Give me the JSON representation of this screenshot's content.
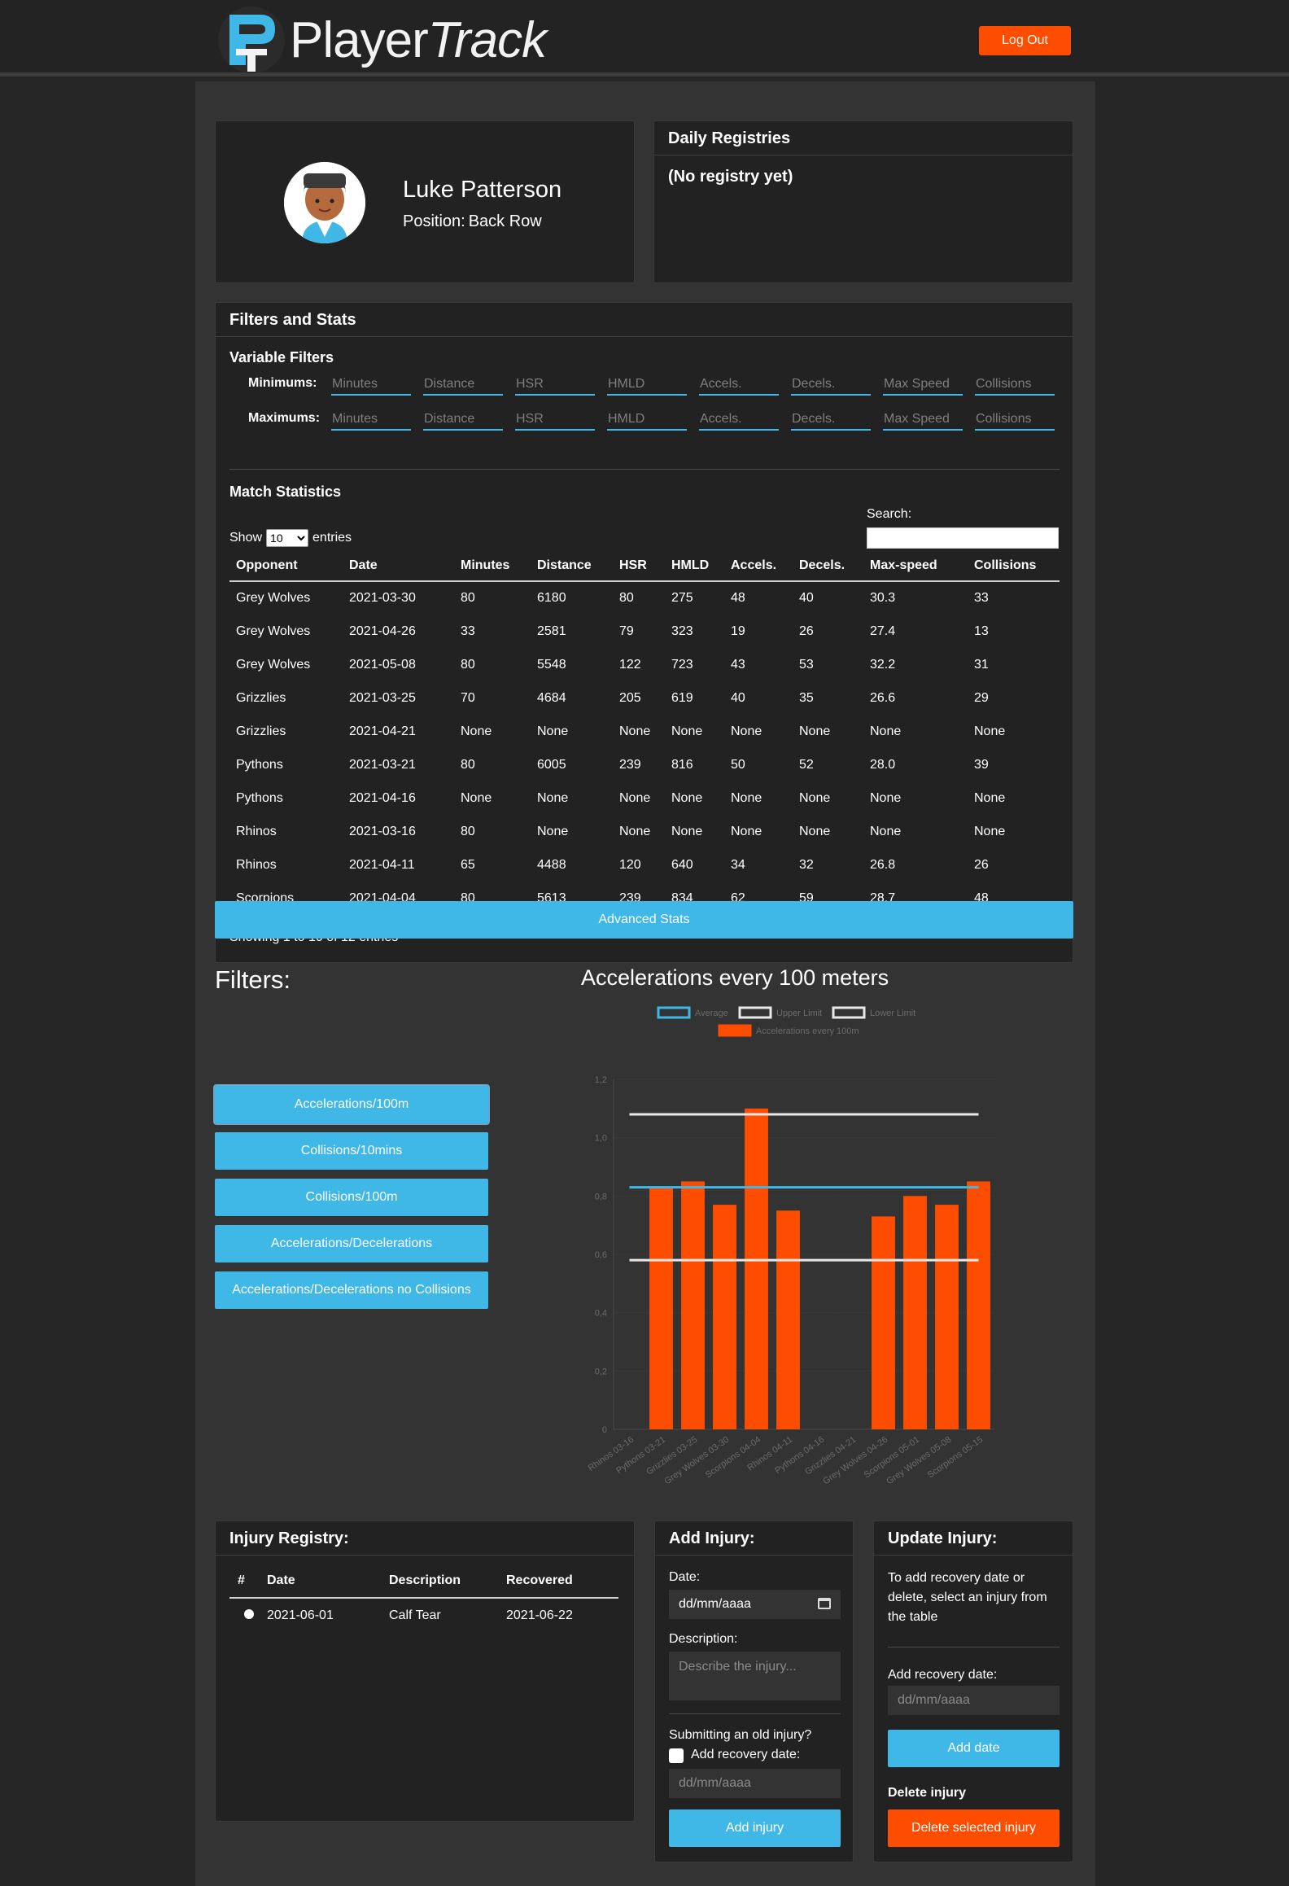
{
  "app": {
    "brand_part1": "Player",
    "brand_part2": "Track",
    "logout_label": "Log Out"
  },
  "profile": {
    "name": "Luke Patterson",
    "position_label": "Position:",
    "position": "Back Row"
  },
  "registries": {
    "title": "Daily Registries",
    "empty": "(No registry yet)"
  },
  "filters_stats": {
    "title": "Filters and Stats",
    "variable_filters_title": "Variable Filters",
    "min_label": "Minimums:",
    "max_label": "Maximums:",
    "placeholders": [
      "Minutes",
      "Distance",
      "HSR",
      "HMLD",
      "Accels.",
      "Decels.",
      "Max Speed",
      "Collisions"
    ],
    "match_stats_title": "Match Statistics",
    "show_label": "Show",
    "entries_label": "entries",
    "entries_value": "10",
    "search_label": "Search:",
    "columns": [
      "Opponent",
      "Date",
      "Minutes",
      "Distance",
      "HSR",
      "HMLD",
      "Accels.",
      "Decels.",
      "Max-speed",
      "Collisions"
    ],
    "rows": [
      [
        "Grey Wolves",
        "2021-03-30",
        "80",
        "6180",
        "80",
        "275",
        "48",
        "40",
        "30.3",
        "33"
      ],
      [
        "Grey Wolves",
        "2021-04-26",
        "33",
        "2581",
        "79",
        "323",
        "19",
        "26",
        "27.4",
        "13"
      ],
      [
        "Grey Wolves",
        "2021-05-08",
        "80",
        "5548",
        "122",
        "723",
        "43",
        "53",
        "32.2",
        "31"
      ],
      [
        "Grizzlies",
        "2021-03-25",
        "70",
        "4684",
        "205",
        "619",
        "40",
        "35",
        "26.6",
        "29"
      ],
      [
        "Grizzlies",
        "2021-04-21",
        "None",
        "None",
        "None",
        "None",
        "None",
        "None",
        "None",
        "None"
      ],
      [
        "Pythons",
        "2021-03-21",
        "80",
        "6005",
        "239",
        "816",
        "50",
        "52",
        "28.0",
        "39"
      ],
      [
        "Pythons",
        "2021-04-16",
        "None",
        "None",
        "None",
        "None",
        "None",
        "None",
        "None",
        "None"
      ],
      [
        "Rhinos",
        "2021-03-16",
        "80",
        "None",
        "None",
        "None",
        "None",
        "None",
        "None",
        "None"
      ],
      [
        "Rhinos",
        "2021-04-11",
        "65",
        "4488",
        "120",
        "640",
        "34",
        "32",
        "26.8",
        "26"
      ],
      [
        "Scorpions",
        "2021-04-04",
        "80",
        "5613",
        "239",
        "834",
        "62",
        "59",
        "28.7",
        "48"
      ]
    ],
    "showing_text": "Showing 1 to 10 of 12 entries"
  },
  "advanced_stats_label": "Advanced Stats",
  "filters_panel": {
    "title": "Filters:",
    "buttons": [
      "Accelerations/100m",
      "Collisions/10mins",
      "Collisions/100m",
      "Accelerations/Decelerations",
      "Accelerations/Decelerations no Collisions"
    ]
  },
  "chart_title": "Accelerations every 100 meters",
  "chart_data": {
    "type": "bar",
    "title": "Accelerations every 100 meters",
    "categories": [
      "Rhinos 03-16",
      "Pythons 03-21",
      "Grizzlies 03-25",
      "Grey Wolves 03-30",
      "Scorpions 04-04",
      "Rhinos 04-11",
      "Pythons 04-16",
      "Grizzlies 04-21",
      "Grey Wolves 04-26",
      "Scorpions 05-01",
      "Grey Wolves 05-08",
      "Scorpions 05-15"
    ],
    "series": [
      {
        "name": "Accelerations every 100m",
        "type": "bar",
        "color": "#ff4d00",
        "values": [
          null,
          0.83,
          0.85,
          0.77,
          1.1,
          0.75,
          null,
          null,
          0.73,
          0.8,
          0.77,
          0.85
        ]
      },
      {
        "name": "Average",
        "type": "line",
        "color": "#3fb8e8",
        "values": [
          0.83,
          0.83,
          0.83,
          0.83,
          0.83,
          0.83,
          0.83,
          0.83,
          0.83,
          0.83,
          0.83,
          0.83
        ]
      },
      {
        "name": "Upper Limit",
        "type": "line",
        "color": "#e8e8e8",
        "values": [
          1.08,
          1.08,
          1.08,
          1.08,
          1.08,
          1.08,
          1.08,
          1.08,
          1.08,
          1.08,
          1.08,
          1.08
        ]
      },
      {
        "name": "Lower Limit",
        "type": "line",
        "color": "#e8e8e8",
        "values": [
          0.58,
          0.58,
          0.58,
          0.58,
          0.58,
          0.58,
          0.58,
          0.58,
          0.58,
          0.58,
          0.58,
          0.58
        ]
      }
    ],
    "ylim": [
      0,
      1.2
    ],
    "yticks": [
      "0",
      "0,2",
      "0,4",
      "0,6",
      "0,8",
      "1,0",
      "1,2"
    ],
    "grid": true,
    "legend": "top"
  },
  "injury_registry": {
    "title": "Injury Registry:",
    "columns": [
      "#",
      "Date",
      "Description",
      "Recovered"
    ],
    "rows": [
      [
        "2021-06-01",
        "Calf Tear",
        "2021-06-22"
      ]
    ]
  },
  "add_injury": {
    "title": "Add Injury:",
    "date_label": "Date:",
    "date_placeholder": "dd/mm/aaaa",
    "description_label": "Description:",
    "description_placeholder": "Describe the injury...",
    "old_injury_label": "Submitting an old injury?",
    "recovery_checkbox_label": "Add recovery date:",
    "recovery_placeholder": "dd/mm/aaaa",
    "submit_label": "Add injury"
  },
  "update_injury": {
    "title": "Update Injury:",
    "instructions": "To add recovery date or delete, select an injury from the table",
    "recovery_label": "Add recovery date:",
    "recovery_placeholder": "dd/mm/aaaa",
    "add_date_label": "Add date",
    "delete_label": "Delete injury",
    "delete_button_label": "Delete selected injury"
  }
}
